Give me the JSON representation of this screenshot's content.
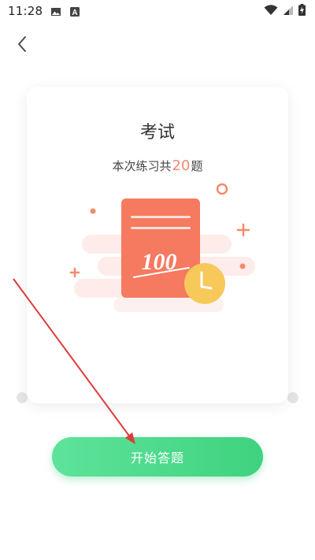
{
  "status_bar": {
    "time": "11:28",
    "icons": [
      "image-icon",
      "a-badge-icon",
      "wifi-icon",
      "signal-icon",
      "battery-charging-icon"
    ]
  },
  "nav": {
    "back_icon": "chevron-left-icon"
  },
  "card": {
    "title": "考试",
    "subtitle_prefix": "本次练习共",
    "question_count": "20",
    "subtitle_suffix": "题",
    "illustration_score": "100"
  },
  "start_button": {
    "label": "开始答题"
  },
  "colors": {
    "accent_green": "#40d27f",
    "paper_orange": "#f57a5f",
    "count_orange": "#f58a6b",
    "clock_yellow": "#f7c95a",
    "annotation_red": "#e03b3b"
  }
}
